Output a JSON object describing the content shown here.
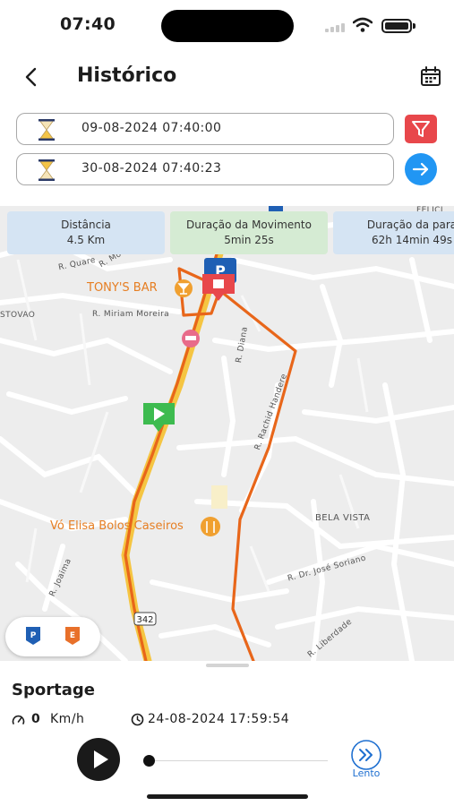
{
  "status_bar": {
    "time": "07:40"
  },
  "header": {
    "title": "Histórico",
    "back_icon": "chevron-left-icon",
    "calendar_icon": "calendar-icon"
  },
  "filters": {
    "start_date": "09-08-2024 07:40:00",
    "end_date": "30-08-2024 07:40:23",
    "start_icon": "hourglass-icon",
    "end_icon": "hourglass-icon",
    "filter_icon": "filter-icon",
    "filter_color": "#e8474b",
    "go_icon": "arrow-right-icon",
    "go_color": "#2196f3"
  },
  "stats": [
    {
      "label": "Distância",
      "value": "4.5 Km"
    },
    {
      "label": "Duração da Movimento",
      "value": "5min 25s"
    },
    {
      "label": "Duração da para",
      "value": "62h 14min 49s"
    }
  ],
  "map": {
    "streets": [
      "R. Quare",
      "R. Mo",
      "R. Miriam Moreira",
      "STOVAO",
      "R. Diana",
      "R. Rachid Handere",
      "BELA VISTA",
      "R. Dr. José Soriano",
      "R. Liberdade",
      "R. Joaima",
      "FELICI"
    ],
    "pois": [
      "TONY'S BAR",
      "Vó Elisa Bolos Caseiros"
    ],
    "route_badge": "342",
    "parking_marker": "P",
    "start_marker": "play-marker-icon",
    "end_marker": "stop-marker-icon",
    "route_color": "#e8661a",
    "legend": [
      {
        "icon": "parking-marker-icon",
        "letter": "P",
        "color": "#1f5fb4"
      },
      {
        "icon": "event-marker-icon",
        "letter": "E",
        "color": "#e8702a"
      }
    ]
  },
  "player": {
    "vehicle": "Sportage",
    "speed_value": "0",
    "speed_unit": "Km/h",
    "speed_icon": "speedometer-icon",
    "time_icon": "clock-icon",
    "timestamp": "24-08-2024 17:59:54",
    "play_icon": "play-icon",
    "playback_position": 0,
    "speed_button_icon": "double-chevron-right-icon",
    "speed_label": "Lento",
    "accent_color": "#1e6fd0"
  }
}
